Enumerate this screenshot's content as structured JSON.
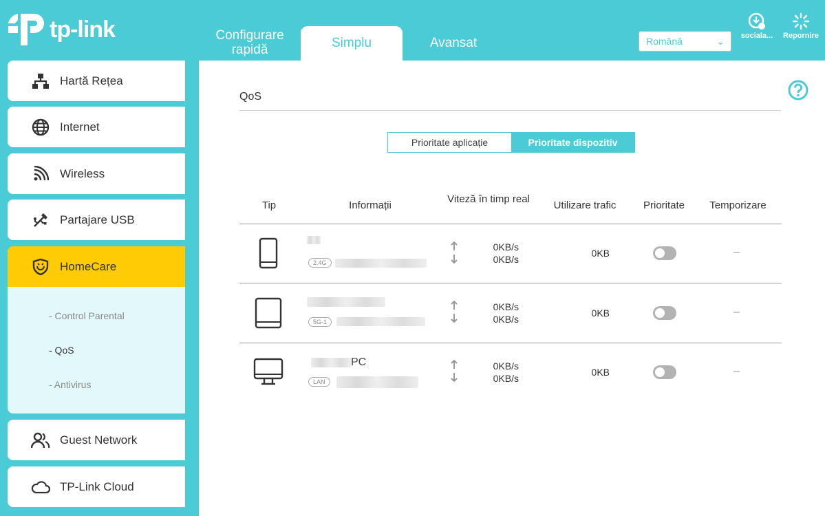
{
  "header": {
    "logo_text": "tp-link",
    "tabs": [
      {
        "label": "Configurare rapidă"
      },
      {
        "label": "Simplu"
      },
      {
        "label": "Avansat"
      }
    ],
    "language": "Română",
    "social_label": "sociala...",
    "reboot_label": "Repornire"
  },
  "sidebar": {
    "items": [
      {
        "label": "Hartă Rețea",
        "icon": "network-map-icon"
      },
      {
        "label": "Internet",
        "icon": "globe-icon"
      },
      {
        "label": "Wireless",
        "icon": "wifi-icon"
      },
      {
        "label": "Partajare USB",
        "icon": "usb-icon"
      },
      {
        "label": "HomeCare",
        "icon": "shield-icon"
      },
      {
        "label": "Guest Network",
        "icon": "guests-icon"
      },
      {
        "label": "TP-Link Cloud",
        "icon": "cloud-icon"
      }
    ],
    "sub_items": [
      {
        "label": "- Control Parental"
      },
      {
        "label": "- QoS"
      },
      {
        "label": "- Antivirus"
      }
    ]
  },
  "main": {
    "title": "QoS",
    "toggle": {
      "app_priority": "Prioritate aplicație",
      "device_priority": "Prioritate dispozitiv"
    },
    "columns": {
      "type": "Tip",
      "info": "Informații",
      "speed": "Viteză în timp real",
      "traffic": "Utilizare trafic",
      "priority": "Prioritate",
      "timing": "Temporizare"
    },
    "rows": [
      {
        "device": "phone",
        "name": "",
        "band": "2.4G",
        "up": "0KB/s",
        "down": "0KB/s",
        "traffic": "0KB",
        "priority_on": false,
        "timing": "–"
      },
      {
        "device": "tablet",
        "name": "",
        "band": "5G-1",
        "up": "0KB/s",
        "down": "0KB/s",
        "traffic": "0KB",
        "priority_on": false,
        "timing": "–"
      },
      {
        "device": "pc",
        "name": "PC",
        "band": "LAN",
        "up": "0KB/s",
        "down": "0KB/s",
        "traffic": "0KB",
        "priority_on": false,
        "timing": "–"
      }
    ]
  },
  "colors": {
    "accent": "#4acbd6",
    "active_menu": "#ffcb05",
    "submenu_bg": "#e2f8fb"
  }
}
